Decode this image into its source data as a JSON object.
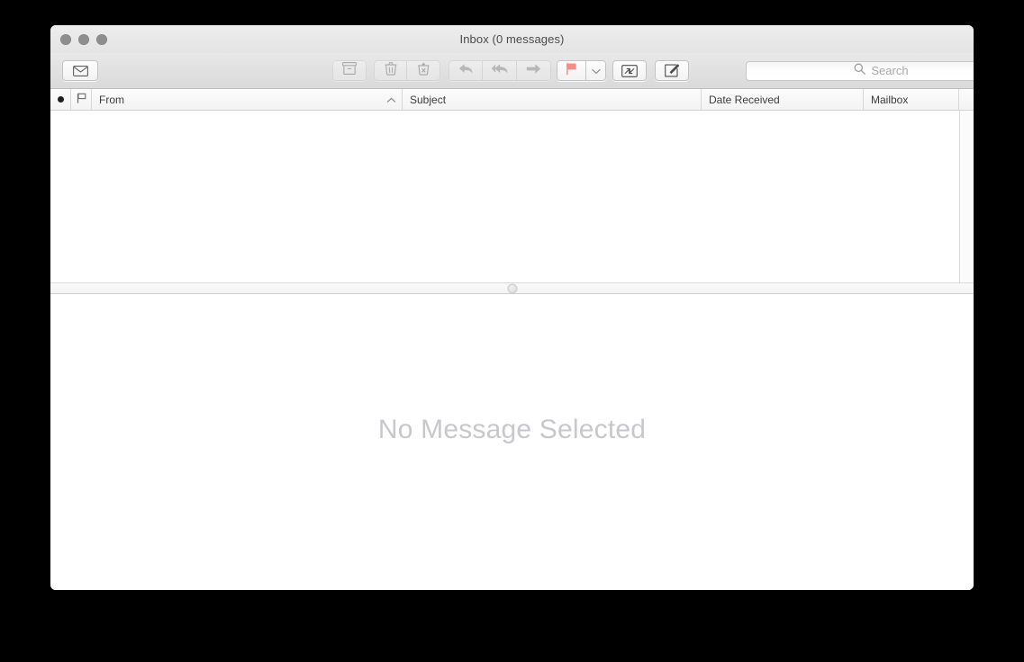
{
  "window": {
    "title": "Inbox (0 messages)",
    "traffic_lights": [
      {
        "name": "close",
        "color": "#8e8e8e"
      },
      {
        "name": "minimize",
        "color": "#8e8e8e"
      },
      {
        "name": "zoom",
        "color": "#8e8e8e"
      }
    ]
  },
  "toolbar": {
    "mailboxes_label": "Mailboxes",
    "archive_label": "Archive",
    "delete_label": "Delete",
    "junk_label": "Junk",
    "reply_label": "Reply",
    "reply_all_label": "Reply All",
    "forward_label": "Forward",
    "flag_label": "Flag",
    "flag_menu_label": "Flag options",
    "flag_color": "#f98d86",
    "move_label": "Move",
    "compose_label": "New Message",
    "icons": {
      "mailboxes": "envelope-icon",
      "archive": "archive-box-icon",
      "delete": "trash-icon",
      "junk": "junk-trash-icon",
      "reply": "reply-arrow-icon",
      "reply_all": "reply-all-arrow-icon",
      "forward": "forward-arrow-icon",
      "flag": "flag-icon",
      "flag_menu": "chevron-down-icon",
      "move": "move-arrows-icon",
      "compose": "compose-pencil-icon"
    }
  },
  "search": {
    "placeholder": "Search",
    "value": "",
    "icon": "search-icon"
  },
  "columns": [
    {
      "id": "unread",
      "label": "",
      "icon": "unread-dot-icon"
    },
    {
      "id": "flag",
      "label": "",
      "icon": "flag-column-icon"
    },
    {
      "id": "from",
      "label": "From",
      "sorted": "ascending",
      "sort_icon": "chevron-up-icon"
    },
    {
      "id": "subject",
      "label": "Subject"
    },
    {
      "id": "date",
      "label": "Date Received"
    },
    {
      "id": "mailbox",
      "label": "Mailbox"
    }
  ],
  "message_list": {
    "rows": [],
    "empty": true
  },
  "preview": {
    "empty_text": "No Message Selected"
  }
}
